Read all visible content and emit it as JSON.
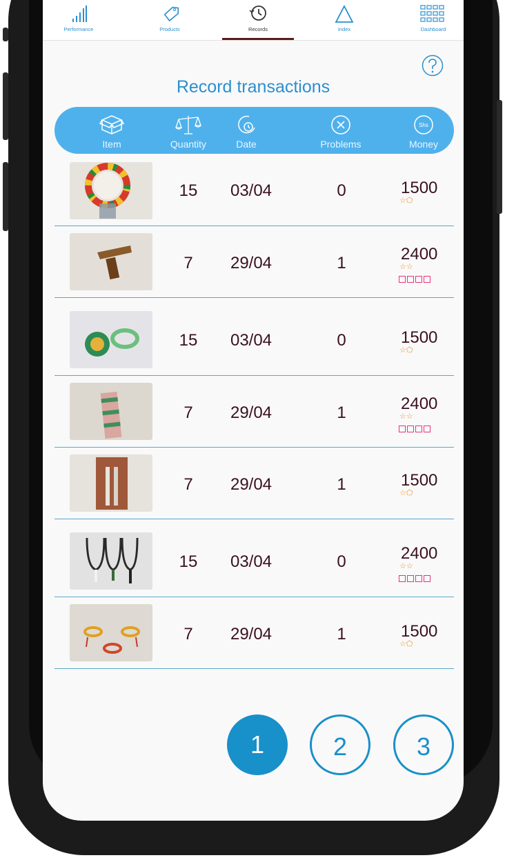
{
  "nav": {
    "items": [
      {
        "label": "Performance",
        "icon": "bar-chart-icon"
      },
      {
        "label": "Products",
        "icon": "tag-icon"
      },
      {
        "label": "Records",
        "icon": "history-icon"
      },
      {
        "label": "Index",
        "icon": "triangle-icon"
      },
      {
        "label": "Dashboard",
        "icon": "grid-icon"
      }
    ],
    "active": "Records"
  },
  "page": {
    "title": "Record transactions",
    "help_icon": "question-icon"
  },
  "table": {
    "columns": [
      {
        "label": "Item",
        "icon": "box-icon"
      },
      {
        "label": "Quantity",
        "icon": "scale-icon"
      },
      {
        "label": "Date",
        "icon": "clock-icon"
      },
      {
        "label": "Problems",
        "icon": "x-circle-icon"
      },
      {
        "label": "Money",
        "icon": "shilling-icon",
        "icon_text": "Shs"
      }
    ],
    "rows": [
      {
        "item": "beaded-collar-image",
        "quantity": "15",
        "date": "03/04",
        "problems": "0",
        "money": "1500",
        "stars": "☆⬠",
        "boxes": 0
      },
      {
        "item": "wooden-carving-image",
        "quantity": "7",
        "date": "29/04",
        "problems": "1",
        "money": "2400",
        "stars": "☆☆",
        "boxes": 4
      },
      {
        "item": "beaded-coaster-bangle-image",
        "quantity": "15",
        "date": "03/04",
        "problems": "0",
        "money": "1500",
        "stars": "☆⬠",
        "boxes": 0
      },
      {
        "item": "beaded-bottle-image",
        "quantity": "7",
        "date": "29/04",
        "problems": "1",
        "money": "2400",
        "stars": "☆☆",
        "boxes": 4
      },
      {
        "item": "beaded-keychain-image",
        "quantity": "7",
        "date": "29/04",
        "problems": "1",
        "money": "1500",
        "stars": "☆⬠",
        "boxes": 0
      },
      {
        "item": "beaded-necklaces-image",
        "quantity": "15",
        "date": "03/04",
        "problems": "0",
        "money": "2400",
        "stars": "☆☆",
        "boxes": 4
      },
      {
        "item": "beaded-bracelets-image",
        "quantity": "7",
        "date": "29/04",
        "problems": "1",
        "money": "1500",
        "stars": "☆⬠",
        "boxes": 0
      }
    ]
  },
  "pagination": {
    "pages": [
      "1",
      "2",
      "3"
    ],
    "current": "1"
  },
  "colors": {
    "accent": "#2b8fcf",
    "header_bg": "#4fb1ec",
    "active_page": "#1890c9",
    "text": "#3a1020",
    "stars": "#f08a1c",
    "boxes": "#e8337a"
  }
}
